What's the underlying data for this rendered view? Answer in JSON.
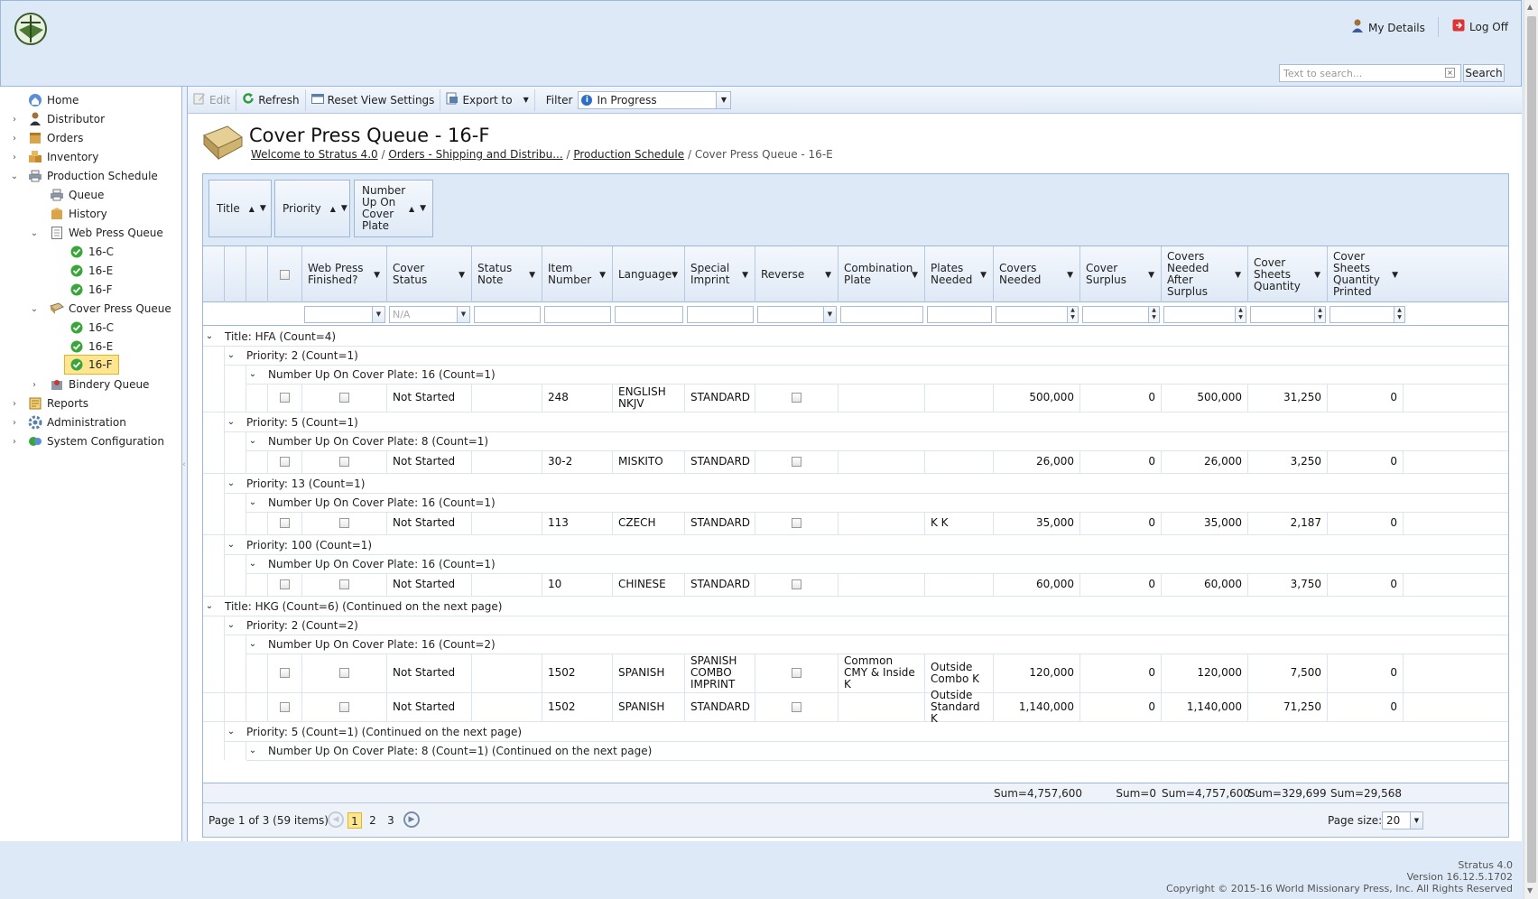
{
  "header": {
    "my_details": "My Details",
    "log_off": "Log Off",
    "search_placeholder": "Text to search...",
    "search_button": "Search"
  },
  "sidebar": {
    "items": [
      {
        "label": "Home",
        "icon": "home-icon"
      },
      {
        "label": "Distributor",
        "icon": "person-icon"
      },
      {
        "label": "Orders",
        "icon": "orders-icon"
      },
      {
        "label": "Inventory",
        "icon": "inventory-icon"
      },
      {
        "label": "Production Schedule",
        "icon": "printer-icon"
      },
      {
        "label": "Queue",
        "icon": "printer-icon"
      },
      {
        "label": "History",
        "icon": "box-icon"
      },
      {
        "label": "Web Press Queue",
        "icon": "document-icon"
      },
      {
        "label": "16-C",
        "icon": "check-icon"
      },
      {
        "label": "16-E",
        "icon": "check-icon"
      },
      {
        "label": "16-F",
        "icon": "check-icon"
      },
      {
        "label": "Cover Press Queue",
        "icon": "book-icon"
      },
      {
        "label": "16-C",
        "icon": "check-icon"
      },
      {
        "label": "16-E",
        "icon": "check-icon"
      },
      {
        "label": "16-F",
        "icon": "check-icon"
      },
      {
        "label": "Bindery Queue",
        "icon": "bindery-icon"
      },
      {
        "label": "Reports",
        "icon": "report-icon"
      },
      {
        "label": "Administration",
        "icon": "gear-icon"
      },
      {
        "label": "System Configuration",
        "icon": "config-icon"
      }
    ]
  },
  "toolbar": {
    "edit": "Edit",
    "refresh": "Refresh",
    "reset": "Reset View Settings",
    "export": "Export to",
    "filter_label": "Filter",
    "filter_value": "In Progress"
  },
  "page": {
    "title": "Cover Press Queue - 16-F",
    "breadcrumb": [
      "Welcome to Stratus 4.0",
      "Orders - Shipping and Distribu...",
      "Production Schedule",
      "Cover Press Queue - 16-E"
    ]
  },
  "grid": {
    "group_chips": [
      "Title",
      "Priority",
      "Number Up On Cover Plate"
    ],
    "columns": [
      "Web Press Finished?",
      "Cover Status",
      "Status Note",
      "Item Number",
      "Language",
      "Special Imprint",
      "Reverse",
      "Combination Plate",
      "Plates Needed",
      "Covers Needed",
      "Cover Surplus",
      "Covers Needed After Surplus",
      "Cover Sheets Quantity",
      "Cover Sheets Quantity Printed"
    ],
    "filter_cover_status": "N/A",
    "groups": [
      {
        "kind": "title",
        "label": "Title: HFA (Count=4)"
      },
      {
        "kind": "priority",
        "label": "Priority: 2 (Count=1)"
      },
      {
        "kind": "nup",
        "label": "Number Up On Cover Plate: 16 (Count=1)"
      },
      {
        "kind": "row",
        "status": "Not Started",
        "item": "248",
        "lang": "ENGLISH NKJV",
        "imprint": "STANDARD",
        "combo": "",
        "plates": "",
        "needed": "500,000",
        "surplus": "0",
        "after": "500,000",
        "sheets": "31,250",
        "printed": "0"
      },
      {
        "kind": "priority",
        "label": "Priority: 5 (Count=1)"
      },
      {
        "kind": "nup",
        "label": "Number Up On Cover Plate: 8 (Count=1)"
      },
      {
        "kind": "row",
        "status": "Not Started",
        "item": "30-2",
        "lang": "MISKITO",
        "imprint": "STANDARD",
        "combo": "",
        "plates": "",
        "needed": "26,000",
        "surplus": "0",
        "after": "26,000",
        "sheets": "3,250",
        "printed": "0"
      },
      {
        "kind": "priority",
        "label": "Priority: 13 (Count=1)"
      },
      {
        "kind": "nup",
        "label": "Number Up On Cover Plate: 16 (Count=1)"
      },
      {
        "kind": "row",
        "status": "Not Started",
        "item": "113",
        "lang": "CZECH",
        "imprint": "STANDARD",
        "combo": "",
        "plates": "K K",
        "needed": "35,000",
        "surplus": "0",
        "after": "35,000",
        "sheets": "2,187",
        "printed": "0"
      },
      {
        "kind": "priority",
        "label": "Priority: 100 (Count=1)"
      },
      {
        "kind": "nup",
        "label": "Number Up On Cover Plate: 16 (Count=1)"
      },
      {
        "kind": "row",
        "status": "Not Started",
        "item": "10",
        "lang": "CHINESE",
        "imprint": "STANDARD",
        "combo": "",
        "plates": "",
        "needed": "60,000",
        "surplus": "0",
        "after": "60,000",
        "sheets": "3,750",
        "printed": "0"
      },
      {
        "kind": "title",
        "label": "Title: HKG (Count=6) (Continued on the next page)"
      },
      {
        "kind": "priority",
        "label": "Priority: 2 (Count=2)"
      },
      {
        "kind": "nup",
        "label": "Number Up On Cover Plate: 16 (Count=2)"
      },
      {
        "kind": "row",
        "status": "Not Started",
        "item": "1502",
        "lang": "SPANISH",
        "imprint": "SPANISH COMBO IMPRINT",
        "combo": "Common CMY & Inside K",
        "plates": "Outside Combo K",
        "needed": "120,000",
        "surplus": "0",
        "after": "120,000",
        "sheets": "7,500",
        "printed": "0"
      },
      {
        "kind": "row",
        "status": "Not Started",
        "item": "1502",
        "lang": "SPANISH",
        "imprint": "STANDARD",
        "combo": "",
        "plates": "Outside Standard K",
        "needed": "1,140,000",
        "surplus": "0",
        "after": "1,140,000",
        "sheets": "71,250",
        "printed": "0"
      },
      {
        "kind": "priority",
        "label": "Priority: 5 (Count=1) (Continued on the next page)"
      },
      {
        "kind": "nup",
        "label": "Number Up On Cover Plate: 8 (Count=1) (Continued on the next page)"
      }
    ],
    "sums": {
      "needed": "Sum=4,757,600",
      "surplus": "Sum=0",
      "after": "Sum=4,757,600",
      "sheets": "Sum=329,699",
      "printed": "Sum=29,568"
    }
  },
  "pager": {
    "info": "Page 1 of 3 (59 items)",
    "pages": [
      "1",
      "2",
      "3"
    ],
    "page_size_label": "Page size:",
    "page_size": "20"
  },
  "footer": {
    "line1": "Stratus 4.0",
    "line2": "Version 16.12.5.1702",
    "line3": "Copyright © 2015-16 World Missionary Press, Inc. All Rights Reserved"
  }
}
